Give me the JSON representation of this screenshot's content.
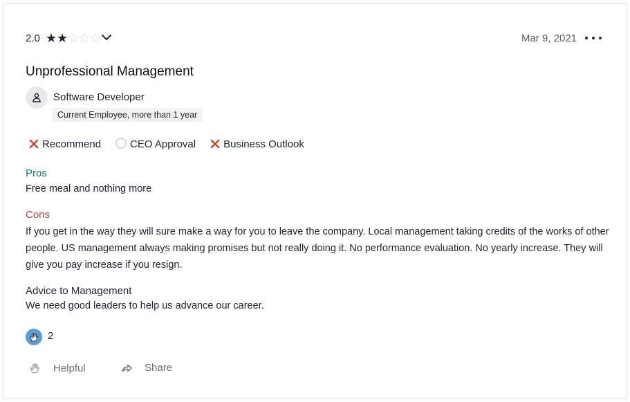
{
  "review": {
    "rating": "2.0",
    "stars_filled": 2,
    "stars_total": 5,
    "date": "Mar 9, 2021",
    "title": "Unprofessional Management",
    "author_role": "Software Developer",
    "tenure": "Current Employee, more than 1 year",
    "indicators": {
      "recommend": "Recommend",
      "ceo_approval": "CEO Approval",
      "business_outlook": "Business Outlook"
    },
    "pros_label": "Pros",
    "pros_text": "Free meal and nothing more",
    "cons_label": "Cons",
    "cons_text": "If you get in the way they will sure make a way for you to leave the company. Local management taking credits of the works of other people. US management always making promises but not really doing it. No performance evaluation. No yearly increase. They will give you pay increase if you resign.",
    "advice_label": "Advice to Management",
    "advice_text": "We need good leaders to help us advance our career.",
    "helpful_count": "2",
    "actions": {
      "helpful": "Helpful",
      "share": "Share"
    }
  },
  "icons": {
    "star": "star-icon",
    "chevron": "chevron-down-icon",
    "more": "more-icon",
    "avatar": "person-icon",
    "negative": "x-icon",
    "neutral": "circle-icon",
    "helpful": "clapping-hands-icon",
    "share": "share-arrow-icon"
  },
  "colors": {
    "pros": "#0c7569",
    "cons": "#b4453a",
    "negative_x": "#c9412d",
    "helpful_badge": "#5a9bd8"
  }
}
